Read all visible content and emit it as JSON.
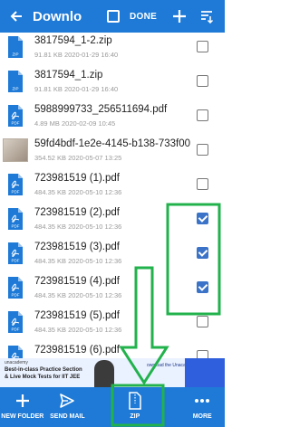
{
  "topbar": {
    "title": "Downlo",
    "done_label": "DONE"
  },
  "files": [
    {
      "name": "3817594_1-2.zip",
      "meta": "91.81 KB 2020-01-29 16:40",
      "type": "zip",
      "checked": false
    },
    {
      "name": "3817594_1.zip",
      "meta": "91.81 KB 2020-01-29 16:40",
      "type": "zip",
      "checked": false
    },
    {
      "name": "5988999733_256511694.pdf",
      "meta": "4.89 MB 2020-02-09 10:45",
      "type": "pdf",
      "checked": false
    },
    {
      "name": "59fd4bdf-1e2e-4145-b138-733f00…",
      "meta": "354.52 KB 2020-05-07 13:25",
      "type": "thumb",
      "checked": false
    },
    {
      "name": "723981519 (1).pdf",
      "meta": "484.35 KB 2020-05-10 12:36",
      "type": "pdf",
      "checked": false
    },
    {
      "name": "723981519 (2).pdf",
      "meta": "484.35 KB 2020-05-10 12:36",
      "type": "pdf",
      "checked": true
    },
    {
      "name": "723981519 (3).pdf",
      "meta": "484.35 KB 2020-05-10 12:36",
      "type": "pdf",
      "checked": true
    },
    {
      "name": "723981519 (4).pdf",
      "meta": "484.35 KB 2020-05-10 12:36",
      "type": "pdf",
      "checked": true
    },
    {
      "name": "723981519 (5).pdf",
      "meta": "484.35 KB 2020-05-10 12:36",
      "type": "pdf",
      "checked": false
    },
    {
      "name": "723981519 (6).pdf",
      "meta": "484.35 KB 2020-05-10 12:36",
      "type": "pdf",
      "checked": false
    }
  ],
  "file_icon_labels": {
    "zip": "ZIP",
    "pdf": "PDF"
  },
  "ad": {
    "brand": "unacademy",
    "line1": "Best-in-class Practice Section",
    "line2": "& Live Mock Tests for IIT JEE",
    "cta": "ownload the Unacademy App"
  },
  "bottombar": [
    {
      "label": "NEW FOLDER",
      "icon": "plus-icon"
    },
    {
      "label": "SEND MAIL",
      "icon": "mail-icon"
    },
    {
      "label": "ZIP",
      "icon": "zip-icon"
    },
    {
      "label": "",
      "icon": ""
    },
    {
      "label": "MORE",
      "icon": "more-icon"
    }
  ],
  "colors": {
    "primary": "#1e7ad6",
    "check": "#3a73c7",
    "annotation": "#22b24c"
  }
}
